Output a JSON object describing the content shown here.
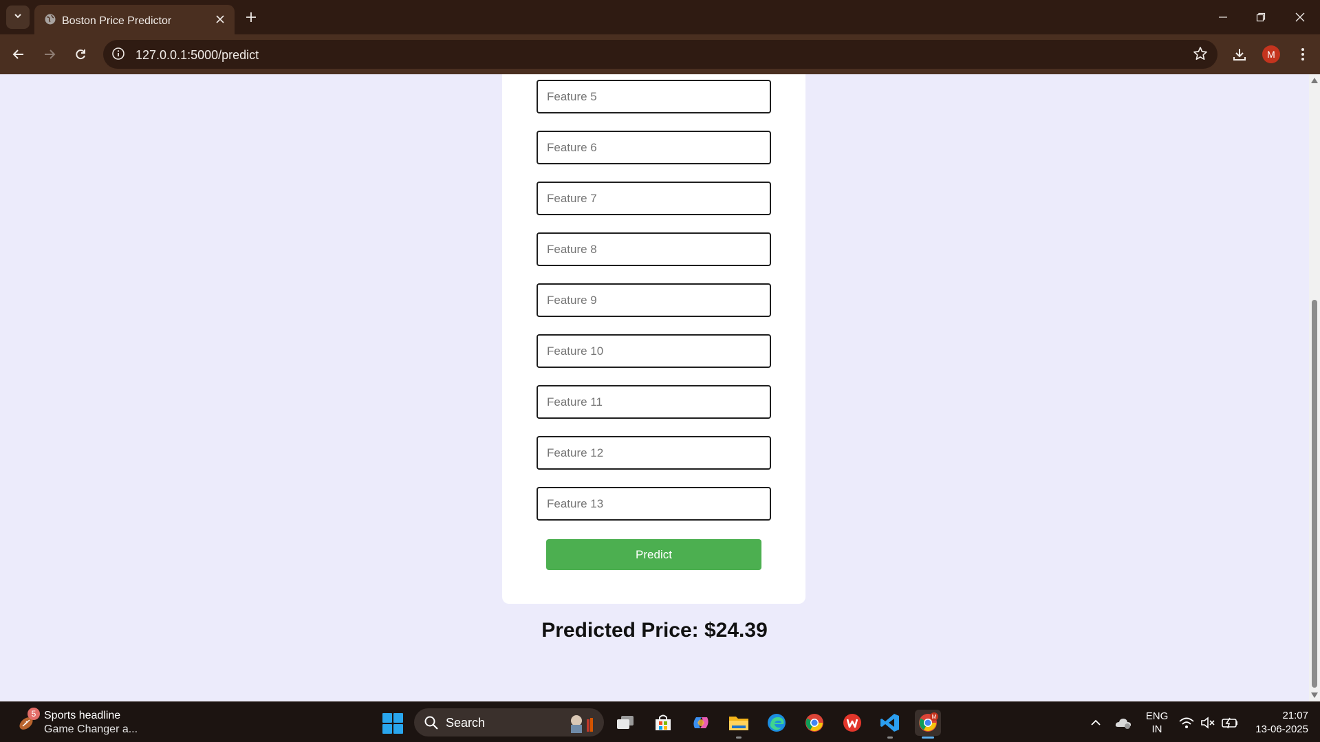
{
  "browser": {
    "tab_title": "Boston Price Predictor",
    "url": "127.0.0.1:5000/predict",
    "profile_initial": "M"
  },
  "form": {
    "fields": [
      {
        "placeholder": "Feature 5"
      },
      {
        "placeholder": "Feature 6"
      },
      {
        "placeholder": "Feature 7"
      },
      {
        "placeholder": "Feature 8"
      },
      {
        "placeholder": "Feature 9"
      },
      {
        "placeholder": "Feature 10"
      },
      {
        "placeholder": "Feature 11"
      },
      {
        "placeholder": "Feature 12"
      },
      {
        "placeholder": "Feature 13"
      }
    ],
    "submit_label": "Predict",
    "button_color": "#4caf50"
  },
  "result": {
    "text": "Predicted Price: $24.39"
  },
  "taskbar": {
    "news_badge": "5",
    "news_title": "Sports headline",
    "news_subtitle": "Game Changer a...",
    "search_label": "Search",
    "language_line1": "ENG",
    "language_line2": "IN",
    "time": "21:07",
    "date": "13-06-2025"
  },
  "colors": {
    "page_background": "#ecebfb",
    "card_background": "#ffffff",
    "chrome_frame": "#2f1b12",
    "chrome_toolbar": "#4a2f20"
  }
}
